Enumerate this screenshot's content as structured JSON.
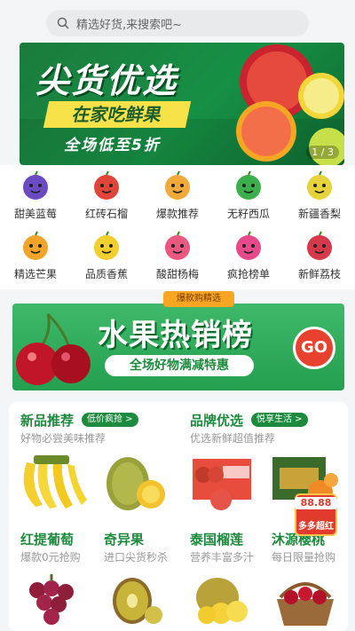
{
  "search": {
    "placeholder": "精选好货,来搜索吧~"
  },
  "banner": {
    "headline": "尖货优选",
    "ribbon": "在家吃鲜果",
    "tagline": "全场低至5折",
    "pager": "1 / 3"
  },
  "categories": [
    {
      "label": "甜美蓝莓",
      "icon": "blueberry-icon",
      "color": "#6a4bc4"
    },
    {
      "label": "红砖石榴",
      "icon": "pomegranate-icon",
      "color": "#e0453a"
    },
    {
      "label": "爆款推荐",
      "icon": "thumbs-up-icon",
      "color": "#f2a93b"
    },
    {
      "label": "无籽西瓜",
      "icon": "watermelon-icon",
      "color": "#3cae4b"
    },
    {
      "label": "新疆香梨",
      "icon": "pear-icon",
      "color": "#e6d23a"
    },
    {
      "label": "精选芒果",
      "icon": "mango-icon",
      "color": "#f0a42a"
    },
    {
      "label": "品质香蕉",
      "icon": "banana-icon",
      "color": "#f2cf2e"
    },
    {
      "label": "酸甜杨梅",
      "icon": "star-fruit-icon",
      "color": "#e9587f"
    },
    {
      "label": "疯抢榜单",
      "icon": "trophy-icon",
      "color": "#e64a8b"
    },
    {
      "label": "新鲜荔枝",
      "icon": "lychee-icon",
      "color": "#d7384a"
    }
  ],
  "promo": {
    "tag": "爆款购精选",
    "title": "水果热销榜",
    "subtitle": "全场好物满减特惠",
    "go": "GO"
  },
  "recommend": {
    "new": {
      "title": "新品推荐",
      "badge": "低价疯抢 >",
      "desc": "好物必尝美味推荐"
    },
    "brand": {
      "title": "品牌优选",
      "badge": "悦享生活 >",
      "desc": "优选新鲜超值推荐"
    },
    "mini": [
      {
        "title": "红提葡萄",
        "desc": "爆款0元抢购"
      },
      {
        "title": "奇异果",
        "desc": "进口尖货秒杀"
      },
      {
        "title": "泰国榴莲",
        "desc": "营养丰富多汁"
      },
      {
        "title": "沐源樱桃",
        "desc": "每日限量抢购"
      }
    ]
  },
  "float_ad": {
    "amount": "88.88",
    "label": "多多超红"
  }
}
